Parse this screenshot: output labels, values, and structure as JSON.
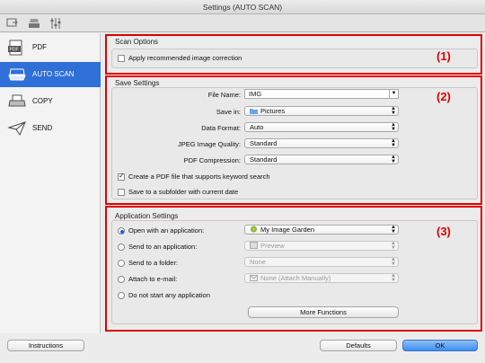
{
  "window": {
    "title": "Settings (AUTO SCAN)"
  },
  "toolbar": {
    "tabs": [
      "scan-from-computer-icon",
      "scan-from-panel-icon",
      "general-settings-icon"
    ]
  },
  "sidebar": {
    "items": [
      {
        "label": "PDF",
        "icon": "pdf-icon"
      },
      {
        "label": "AUTO SCAN",
        "icon": "auto-scan-icon"
      },
      {
        "label": "COPY",
        "icon": "copy-icon"
      },
      {
        "label": "SEND",
        "icon": "send-icon"
      }
    ],
    "selected": "AUTO SCAN"
  },
  "markers": [
    "(1)",
    "(2)",
    "(3)"
  ],
  "scan_options": {
    "title": "Scan Options",
    "apply_correction": {
      "label": "Apply recommended image correction",
      "checked": false
    }
  },
  "save_settings": {
    "title": "Save Settings",
    "file_name": {
      "label": "File Name:",
      "value": "IMG"
    },
    "save_in": {
      "label": "Save in:",
      "value": "Pictures"
    },
    "data_format": {
      "label": "Data Format:",
      "value": "Auto"
    },
    "jpeg_quality": {
      "label": "JPEG Image Quality:",
      "value": "Standard"
    },
    "pdf_compression": {
      "label": "PDF Compression:",
      "value": "Standard"
    },
    "keyword_pdf": {
      "label": "Create a PDF file that supports keyword search",
      "checked": true
    },
    "subfolder": {
      "label": "Save to a subfolder with current date",
      "checked": false
    }
  },
  "application_settings": {
    "title": "Application Settings",
    "open_app": {
      "label": "Open with an application:",
      "value": "My Image Garden",
      "selected": true
    },
    "send_app": {
      "label": "Send to an application:",
      "value": "Preview",
      "selected": false
    },
    "send_folder": {
      "label": "Send to a folder:",
      "value": "None",
      "selected": false
    },
    "attach_email": {
      "label": "Attach to e-mail:",
      "value": "None (Attach Manually)",
      "selected": false
    },
    "no_app": {
      "label": "Do not start any application",
      "selected": false
    },
    "more_functions": "More Functions"
  },
  "footer": {
    "instructions": "Instructions",
    "defaults": "Defaults",
    "ok": "OK"
  },
  "colors": {
    "highlight": "#e00000",
    "selection": "#2e6fd8",
    "ok_button": "#3d8ff0"
  }
}
